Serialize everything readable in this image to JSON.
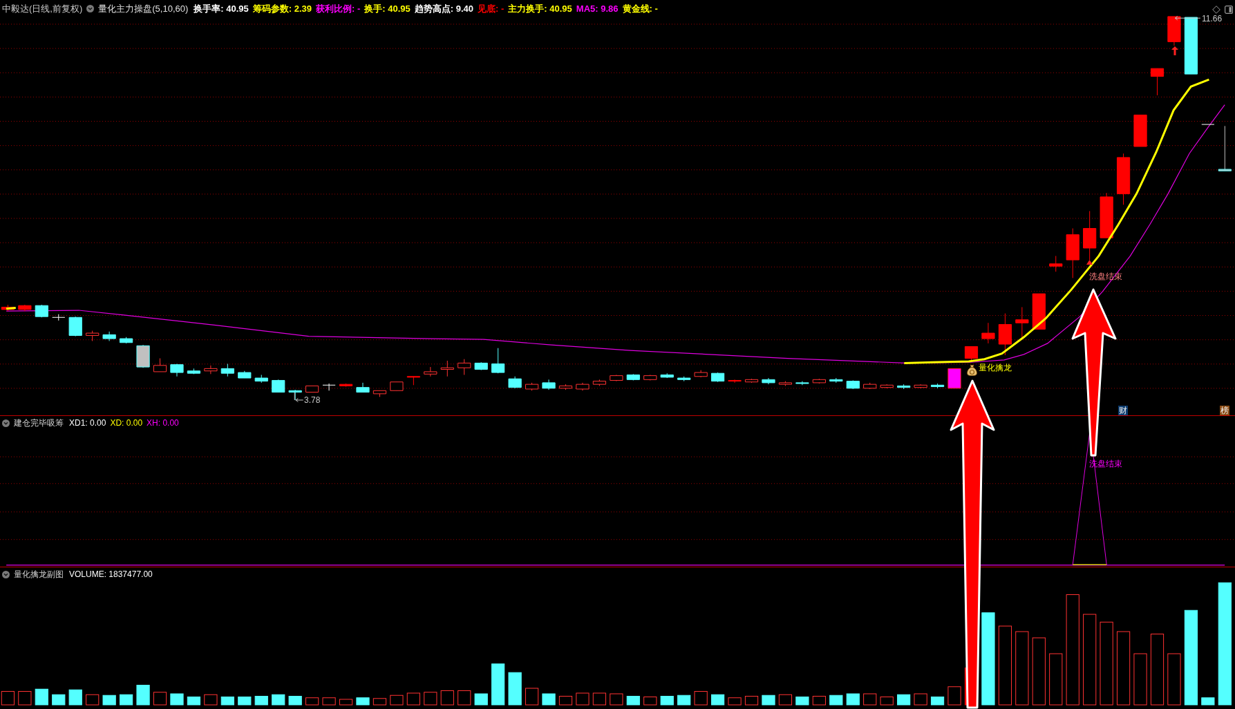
{
  "header": {
    "security": "中毅达(日线,前复权)",
    "indicator": "量化主力操盘(5,10,60)",
    "readouts": [
      {
        "text": "换手率: 40.95",
        "color": "#ffffff"
      },
      {
        "text": "筹码参数: 2.39",
        "color": "#ffff00"
      },
      {
        "text": "获利比例: -",
        "color": "#ff00ff"
      },
      {
        "text": "换手: 40.95",
        "color": "#ffff00"
      },
      {
        "text": "趋势高点: 9.40",
        "color": "#ffffff"
      },
      {
        "text": "见底: -",
        "color": "#ff0000"
      },
      {
        "text": "主力换手: 40.95",
        "color": "#ffff00"
      },
      {
        "text": "MA5: 9.86",
        "color": "#ff00ff"
      },
      {
        "text": "黄金线: -",
        "color": "#ffff00"
      }
    ]
  },
  "price_chart": {
    "high_label": "11.66",
    "low_label": "3.78",
    "buy_signal": "量化擒龙",
    "wash_signal": "洗盘结束",
    "tags": [
      {
        "text": "财",
        "color": "#0c3b6e"
      },
      {
        "text": "榜",
        "color": "#8a4b14"
      }
    ]
  },
  "signal_panel": {
    "title": "建仓完毕吸筹",
    "readouts": [
      {
        "text": "XD1: 0.00",
        "color": "#ffffff"
      },
      {
        "text": "XD: 0.00",
        "color": "#ffff00"
      },
      {
        "text": "XH: 0.00",
        "color": "#ff00ff"
      }
    ],
    "signal": "洗盘结束"
  },
  "volume_panel": {
    "title": "量化擒龙副图",
    "readouts": [
      {
        "text": "VOLUME: 1837477.00",
        "color": "#ffffff"
      }
    ]
  }
}
